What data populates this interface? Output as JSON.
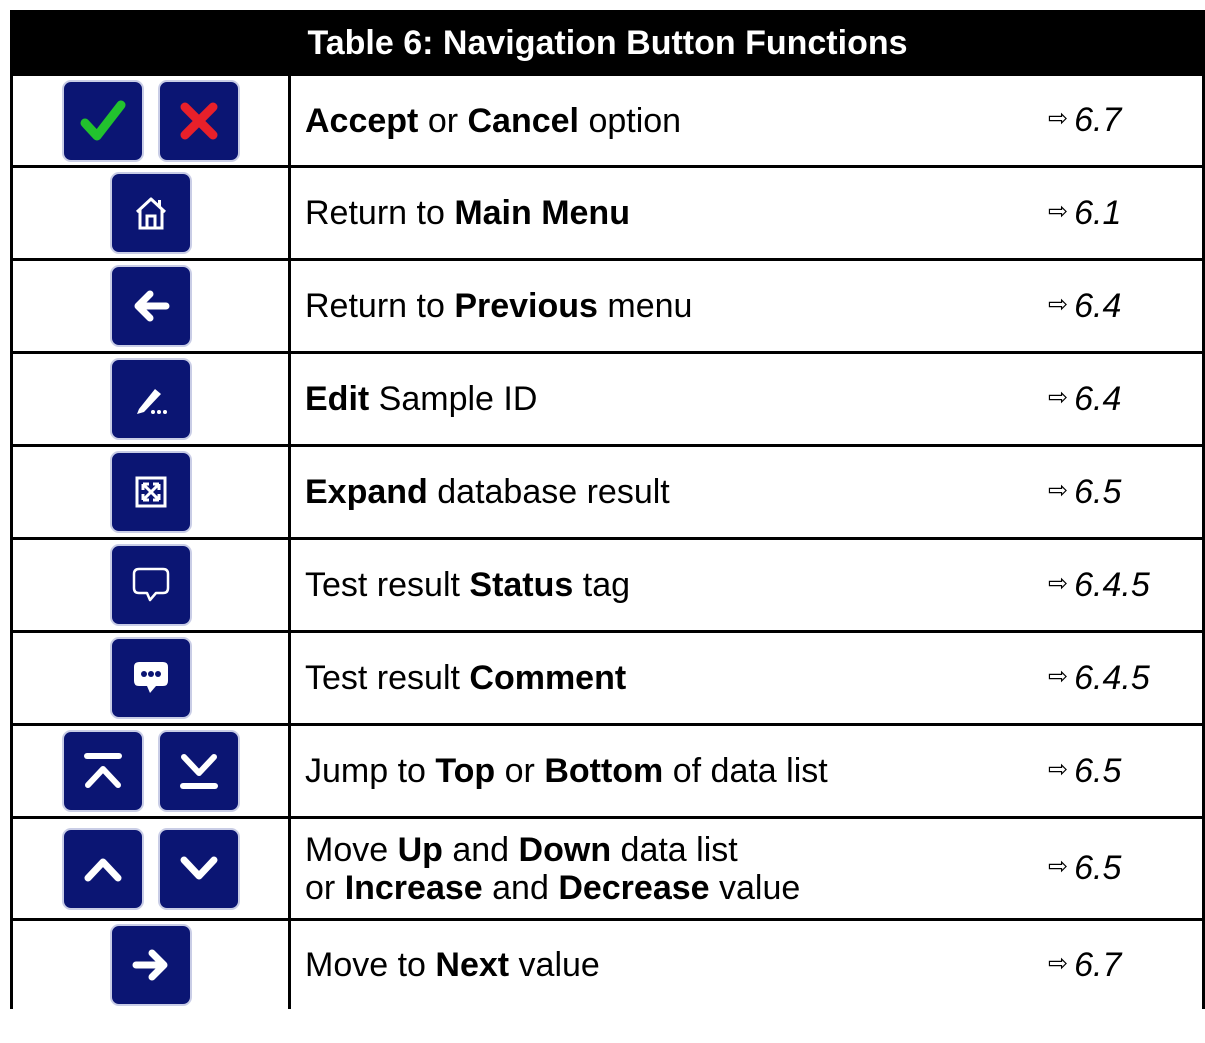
{
  "title": "Table 6: Navigation Button Functions",
  "ref_arrow_glyph": "⇨",
  "rows": [
    {
      "icons": [
        "check-icon",
        "cross-icon"
      ],
      "desc": [
        {
          "t": "Accept",
          "b": true
        },
        {
          "t": " or ",
          "b": false
        },
        {
          "t": "Cancel",
          "b": true
        },
        {
          "t": " option",
          "b": false
        }
      ],
      "ref": "6.7"
    },
    {
      "icons": [
        "home-icon"
      ],
      "desc": [
        {
          "t": "Return to ",
          "b": false
        },
        {
          "t": "Main Menu",
          "b": true
        }
      ],
      "ref": "6.1"
    },
    {
      "icons": [
        "arrow-left-icon"
      ],
      "desc": [
        {
          "t": "Return to ",
          "b": false
        },
        {
          "t": "Previous",
          "b": true
        },
        {
          "t": " menu",
          "b": false
        }
      ],
      "ref": "6.4"
    },
    {
      "icons": [
        "edit-pencil-icon"
      ],
      "desc": [
        {
          "t": "Edit",
          "b": true
        },
        {
          "t": " Sample ID",
          "b": false
        }
      ],
      "ref": "6.4"
    },
    {
      "icons": [
        "expand-icon"
      ],
      "desc": [
        {
          "t": "Expand",
          "b": true
        },
        {
          "t": " database result",
          "b": false
        }
      ],
      "ref": "6.5"
    },
    {
      "icons": [
        "speech-bubble-outline-icon"
      ],
      "desc": [
        {
          "t": "Test result ",
          "b": false
        },
        {
          "t": "Status",
          "b": true
        },
        {
          "t": " tag",
          "b": false
        }
      ],
      "ref": "6.4.5"
    },
    {
      "icons": [
        "speech-bubble-comment-icon"
      ],
      "desc": [
        {
          "t": "Test result ",
          "b": false
        },
        {
          "t": "Comment",
          "b": true
        }
      ],
      "ref": "6.4.5"
    },
    {
      "icons": [
        "jump-top-icon",
        "jump-bottom-icon"
      ],
      "desc": [
        {
          "t": "Jump to ",
          "b": false
        },
        {
          "t": "Top",
          "b": true
        },
        {
          "t": " or ",
          "b": false
        },
        {
          "t": "Bottom",
          "b": true
        },
        {
          "t": " of data list",
          "b": false
        }
      ],
      "ref": "6.5"
    },
    {
      "icons": [
        "chevron-up-icon",
        "chevron-down-icon"
      ],
      "desc_lines": [
        [
          {
            "t": "Move ",
            "b": false
          },
          {
            "t": "Up",
            "b": true
          },
          {
            "t": " and ",
            "b": false
          },
          {
            "t": "Down",
            "b": true
          },
          {
            "t": " data list",
            "b": false
          }
        ],
        [
          {
            "t": "or ",
            "b": false
          },
          {
            "t": "Increase",
            "b": true
          },
          {
            "t": " and ",
            "b": false
          },
          {
            "t": "Decrease",
            "b": true
          },
          {
            "t": " value",
            "b": false
          }
        ]
      ],
      "ref": "6.5"
    },
    {
      "icons": [
        "arrow-right-icon"
      ],
      "desc": [
        {
          "t": "Move to ",
          "b": false
        },
        {
          "t": "Next",
          "b": true
        },
        {
          "t": " value",
          "b": false
        }
      ],
      "ref": "6.7"
    }
  ],
  "colors": {
    "button_bg": "#0b1573",
    "check": "#22c22e",
    "cross": "#e8202a",
    "icon_fg": "#ffffff"
  }
}
